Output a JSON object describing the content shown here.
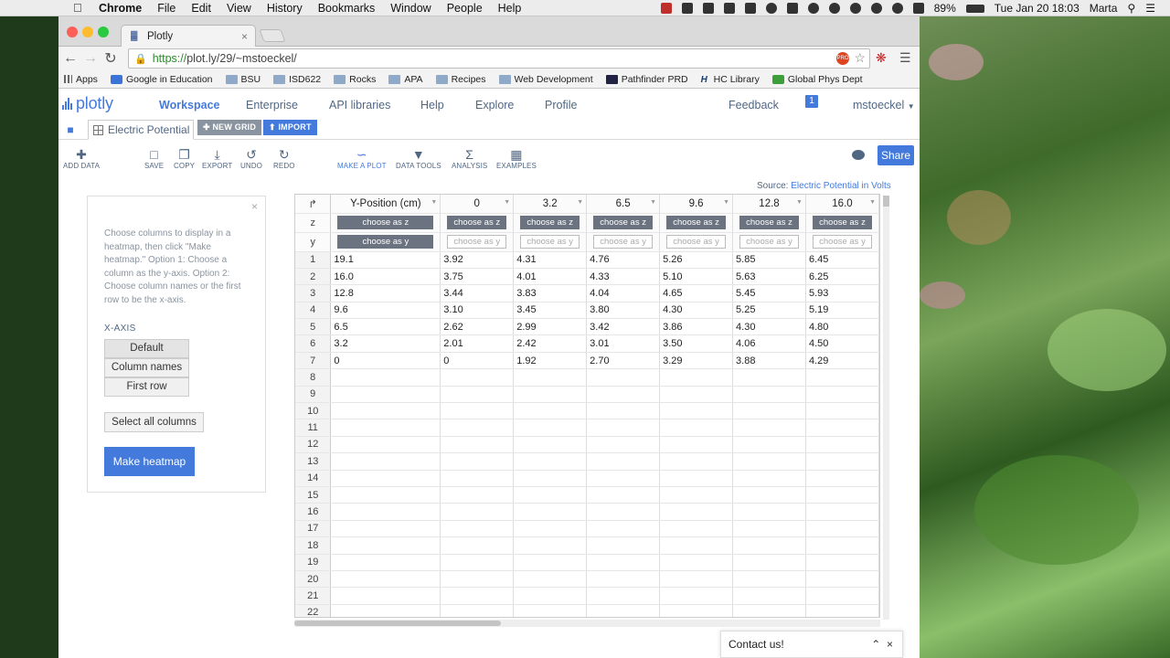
{
  "menubar": {
    "app": "Chrome",
    "menus": [
      "File",
      "Edit",
      "View",
      "History",
      "Bookmarks",
      "Window",
      "People",
      "Help"
    ],
    "battery": "89%",
    "clock": "Tue Jan 20  18:03",
    "user": "Marta"
  },
  "browser": {
    "tab_title": "Plotly",
    "url_scheme": "https://",
    "url_rest": "plot.ly/29/~mstoeckel/",
    "bookmarks": [
      "Apps",
      "Google in Education",
      "BSU",
      "ISD622",
      "Rocks",
      "APA",
      "Recipes",
      "Web Development",
      "Pathfinder PRD",
      "HC Library",
      "Global Phys Dept"
    ],
    "bookmark_more": "»",
    "ext_label": "PRO"
  },
  "plotly": {
    "logo": "plotly",
    "nav": [
      "Workspace",
      "Enterprise",
      "API libraries",
      "Help",
      "Explore",
      "Profile"
    ],
    "feedback": "Feedback",
    "notif_count": "1",
    "username": "mstoeckel"
  },
  "worktabs": {
    "grid_name": "Electric Potential",
    "new_grid": "NEW GRID",
    "import": "IMPORT"
  },
  "tools": {
    "add_data": "ADD DATA",
    "save": "SAVE",
    "copy": "COPY",
    "export": "EXPORT",
    "undo": "UNDO",
    "redo": "REDO",
    "make_plot": "MAKE A PLOT",
    "data_tools": "DATA TOOLS",
    "analysis": "ANALYSIS",
    "examples": "EXAMPLES",
    "share": "Share"
  },
  "source": {
    "label": "Source:",
    "link": "Electric Potential in Volts"
  },
  "heatmap_panel": {
    "description": "Choose columns to display in a heatmap, then click \"Make heatmap.\" Option 1: Choose a column as the y-axis. Option 2: Choose column names or the first row to be the x-axis.",
    "xaxis_label": "X-AXIS",
    "options": [
      "Default",
      "Column names",
      "First row"
    ],
    "select_all": "Select all columns",
    "make_heatmap": "Make heatmap"
  },
  "grid": {
    "corner": "↱",
    "z_label": "z",
    "y_label": "y",
    "choose_z": "choose as z",
    "choose_y": "choose as y",
    "columns": [
      "Y-Position (cm)",
      "0",
      "3.2",
      "6.5",
      "9.6",
      "12.8",
      "16.0"
    ],
    "rows": [
      [
        "19.1",
        "3.92",
        "4.31",
        "4.76",
        "5.26",
        "5.85",
        "6.45"
      ],
      [
        "16.0",
        "3.75",
        "4.01",
        "4.33",
        "5.10",
        "5.63",
        "6.25"
      ],
      [
        "12.8",
        "3.44",
        "3.83",
        "4.04",
        "4.65",
        "5.45",
        "5.93"
      ],
      [
        "9.6",
        "3.10",
        "3.45",
        "3.80",
        "4.30",
        "5.25",
        "5.19"
      ],
      [
        "6.5",
        "2.62",
        "2.99",
        "3.42",
        "3.86",
        "4.30",
        "4.80"
      ],
      [
        "3.2",
        "2.01",
        "2.42",
        "3.01",
        "3.50",
        "4.06",
        "4.50"
      ],
      [
        "0",
        "0",
        "1.92",
        "2.70",
        "3.29",
        "3.88",
        "4.29"
      ]
    ],
    "row_numbers": [
      "1",
      "2",
      "3",
      "4",
      "5",
      "6",
      "7",
      "8",
      "9",
      "10",
      "11",
      "12",
      "13",
      "14",
      "15",
      "16",
      "17",
      "18",
      "19",
      "20",
      "21",
      "22"
    ]
  },
  "contact": {
    "label": "Contact us!"
  }
}
